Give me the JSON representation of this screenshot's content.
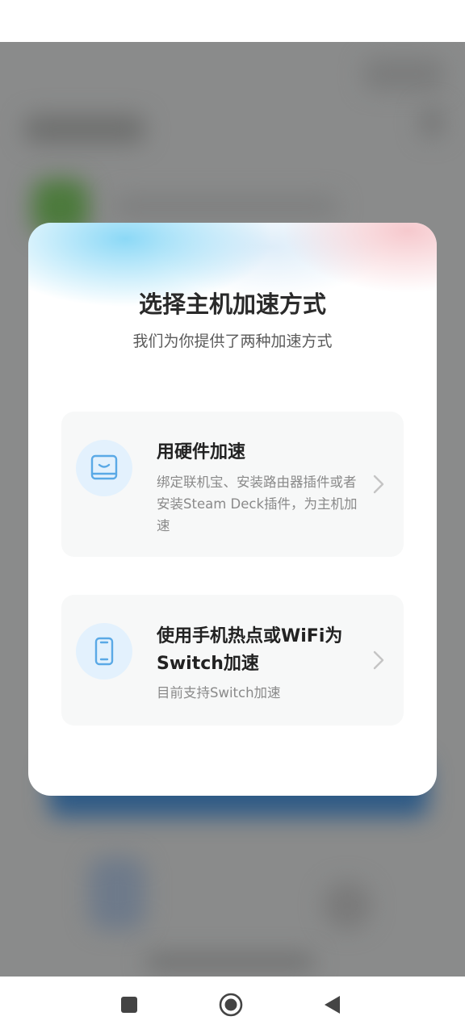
{
  "dialog": {
    "title": "选择主机加速方式",
    "subtitle": "我们为你提供了两种加速方式"
  },
  "options": [
    {
      "title": "用硬件加速",
      "description": "绑定联机宝、安装路由器插件或者安装Steam Deck插件，为主机加速",
      "icon": "router-box-icon"
    },
    {
      "title": "使用手机热点或WiFi为Switch加速",
      "description": "目前支持Switch加速",
      "icon": "phone-icon"
    }
  ],
  "colors": {
    "accent_icon": "#5aa9e6",
    "icon_bg": "#e3f1fd",
    "card_bg": "#f7f8f8",
    "scrim": "#8a8b8b"
  },
  "nav": {
    "recent_icon": "square-icon",
    "home_icon": "circle-icon",
    "back_icon": "triangle-back-icon"
  }
}
